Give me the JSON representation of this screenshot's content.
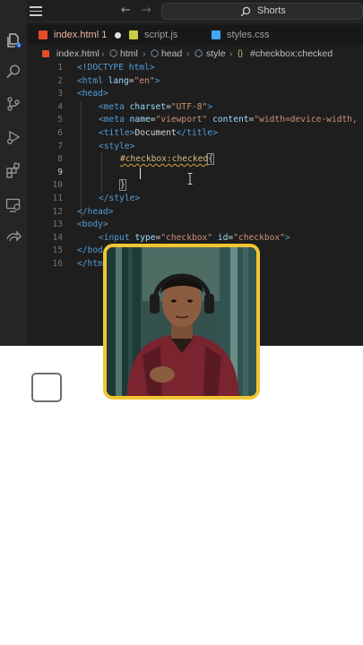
{
  "window": {
    "search_text": "Shorts"
  },
  "tabs": [
    {
      "label": "index.html 1",
      "icon": "html5-icon",
      "modified": true,
      "active": true
    },
    {
      "label": "script.js",
      "icon": "js-icon",
      "active": false
    },
    {
      "label": "styles.css",
      "icon": "css3-icon",
      "active": false
    }
  ],
  "breadcrumb": {
    "items": [
      "index.html",
      "html",
      "head",
      "style",
      "#checkbox:checked"
    ]
  },
  "code": {
    "line_numbers": [
      "1",
      "2",
      "3",
      "4",
      "5",
      "6",
      "7",
      "8",
      "9",
      "10",
      "11",
      "12",
      "13",
      "14",
      "15",
      "16"
    ],
    "current_line": "9",
    "lines": {
      "l1": "<!DOCTYPE html>",
      "l2_open": "<html ",
      "l2_attr": "lang",
      "l2_eq": "=",
      "l2_val": "\"en\"",
      "l2_close": ">",
      "l3": "<head>",
      "l4_open": "<meta ",
      "l4_attr": "charset",
      "l4_eq": "=",
      "l4_val": "\"UTF-8\"",
      "l4_close": ">",
      "l5_open": "<meta ",
      "l5_attr1": "name",
      "l5_eq1": "=",
      "l5_val1": "\"viewport\"",
      "l5_attr2": " content",
      "l5_eq2": "=",
      "l5_val2": "\"width=device-width,",
      "l6_open": "<title>",
      "l6_text": "Document",
      "l6_close": "</title>",
      "l7": "<style>",
      "l8_sel": "#checkbox:checked",
      "l8_brace": "{",
      "l10": "}",
      "l11": "</style>",
      "l12": "</head>",
      "l13": "<body>",
      "l14_open": "<input ",
      "l14_attr1": "type",
      "l14_eq1": "=",
      "l14_val1": "\"checkbox\"",
      "l14_attr2": " id",
      "l14_eq2": "=",
      "l14_val2": "\"checkbox\"",
      "l14_close": ">",
      "l15": "</bod",
      "l16": "</htm"
    }
  },
  "colors": {
    "editor_bg": "#1e1e1e",
    "tag": "#569cd6",
    "attribute": "#9cdcfe",
    "string": "#ce9178",
    "selector": "#d7ba7d",
    "webcam_border": "#f2c531"
  },
  "icons": {
    "logo": "vscode-logo-icon",
    "activity": [
      "explorer-icon",
      "search-icon",
      "source-control-icon",
      "run-debug-icon",
      "extensions-icon",
      "remote-explorer-icon",
      "live-share-icon"
    ]
  },
  "preview": {
    "checkbox_checked": false
  }
}
